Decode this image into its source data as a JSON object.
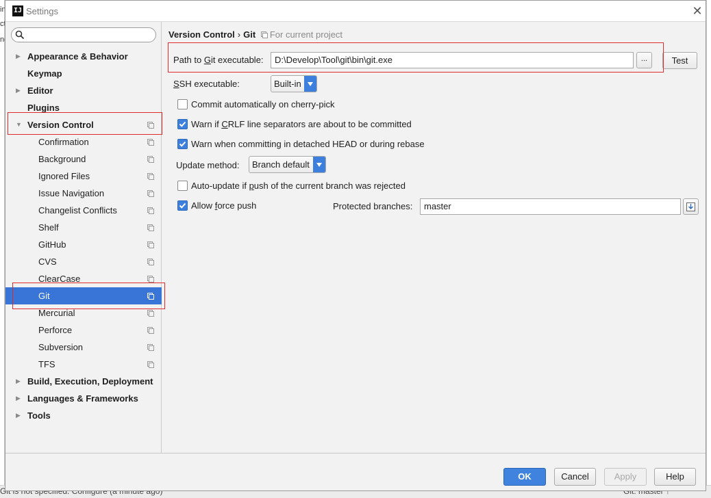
{
  "window": {
    "title": "Settings",
    "app_icon_text": "IJ"
  },
  "background": {
    "left_fragments": [
      "in",
      "ct",
      "ng"
    ],
    "status_left": "Git is not specified. Configure (a minute ago)",
    "status_right": "Git: master ↑"
  },
  "sidebar": {
    "search_placeholder": "",
    "items": [
      {
        "label": "Appearance & Behavior",
        "level": 0,
        "arrow": "▶"
      },
      {
        "label": "Keymap",
        "level": 0
      },
      {
        "label": "Editor",
        "level": 0,
        "arrow": "▶"
      },
      {
        "label": "Plugins",
        "level": 0
      },
      {
        "label": "Version Control",
        "level": 0,
        "arrow": "▼"
      },
      {
        "label": "Confirmation",
        "level": 1
      },
      {
        "label": "Background",
        "level": 1
      },
      {
        "label": "Ignored Files",
        "level": 1
      },
      {
        "label": "Issue Navigation",
        "level": 1
      },
      {
        "label": "Changelist Conflicts",
        "level": 1
      },
      {
        "label": "Shelf",
        "level": 1
      },
      {
        "label": "GitHub",
        "level": 1
      },
      {
        "label": "CVS",
        "level": 1
      },
      {
        "label": "ClearCase",
        "level": 1
      },
      {
        "label": "Git",
        "level": 1,
        "selected": true
      },
      {
        "label": "Mercurial",
        "level": 1
      },
      {
        "label": "Perforce",
        "level": 1
      },
      {
        "label": "Subversion",
        "level": 1
      },
      {
        "label": "TFS",
        "level": 1
      },
      {
        "label": "Build, Execution, Deployment",
        "level": 0,
        "arrow": "▶"
      },
      {
        "label": "Languages & Frameworks",
        "level": 0,
        "arrow": "▶"
      },
      {
        "label": "Tools",
        "level": 0,
        "arrow": "▶"
      }
    ]
  },
  "breadcrumb": {
    "parent": "Version Control",
    "separator": "›",
    "current": "Git",
    "scope": "For current project"
  },
  "git": {
    "path_label_pre": "Path to ",
    "path_label_u": "G",
    "path_label_post": "it executable:",
    "path_value": "D:\\Develop\\Tool\\git\\bin\\git.exe",
    "browse_label": "...",
    "test_label": "Test",
    "ssh_label_u": "S",
    "ssh_label_post": "SH executable:",
    "ssh_value": "Built-in",
    "commit_cherry": {
      "pre": "Commit automatically on cherry-pick",
      "checked": false
    },
    "warn_crlf": {
      "pre": "Warn if ",
      "u": "C",
      "post": "RLF line separators are about to be committed",
      "checked": true
    },
    "warn_detached": {
      "pre": "Warn when committing in detached HEAD or during rebase",
      "checked": true
    },
    "update_method_label": "Update method:",
    "update_method_value": "Branch default",
    "auto_update": {
      "pre": "Auto-update if ",
      "u": "p",
      "post": "ush of the current branch was rejected",
      "checked": false
    },
    "allow_force": {
      "pre": "Allow ",
      "u": "f",
      "post": "orce push",
      "checked": true
    },
    "protected_label": "Protected branches:",
    "protected_value": "master"
  },
  "footer": {
    "ok": "OK",
    "cancel": "Cancel",
    "apply": "Apply",
    "help": "Help"
  },
  "colors": {
    "selection": "#3875d7",
    "highlight_box": "#e22a2a",
    "checkbox_checked": "#3d7fdc"
  }
}
